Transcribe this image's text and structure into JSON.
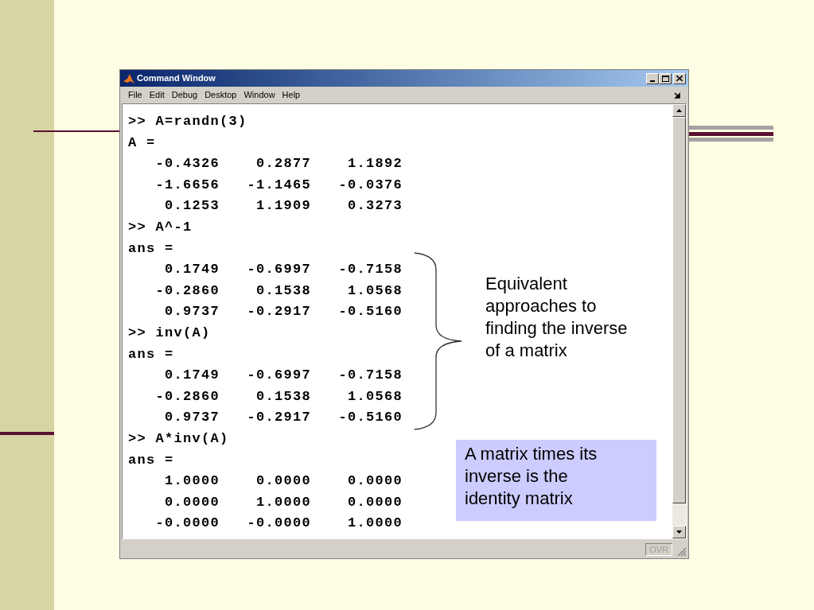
{
  "window": {
    "title": "Command Window",
    "menu": [
      "File",
      "Edit",
      "Debug",
      "Desktop",
      "Window",
      "Help"
    ],
    "lines": [
      ">> A=randn(3)",
      "A =",
      "   -0.4326    0.2877    1.1892",
      "   -1.6656   -1.1465   -0.0376",
      "    0.1253    1.1909    0.3273",
      ">> A^-1",
      "ans =",
      "    0.1749   -0.6997   -0.7158",
      "   -0.2860    0.1538    1.0568",
      "    0.9737   -0.2917   -0.5160",
      ">> inv(A)",
      "ans =",
      "    0.1749   -0.6997   -0.7158",
      "   -0.2860    0.1538    1.0568",
      "    0.9737   -0.2917   -0.5160",
      ">> A*inv(A)",
      "ans =",
      "    1.0000    0.0000    0.0000",
      "    0.0000    1.0000    0.0000",
      "   -0.0000   -0.0000    1.0000"
    ],
    "status_bar": {
      "indicator": "OVR"
    }
  },
  "annotations": {
    "brace_note": "Equivalent approaches to finding the inverse of a matrix",
    "box_note": "A matrix times its inverse is the identity matrix"
  }
}
